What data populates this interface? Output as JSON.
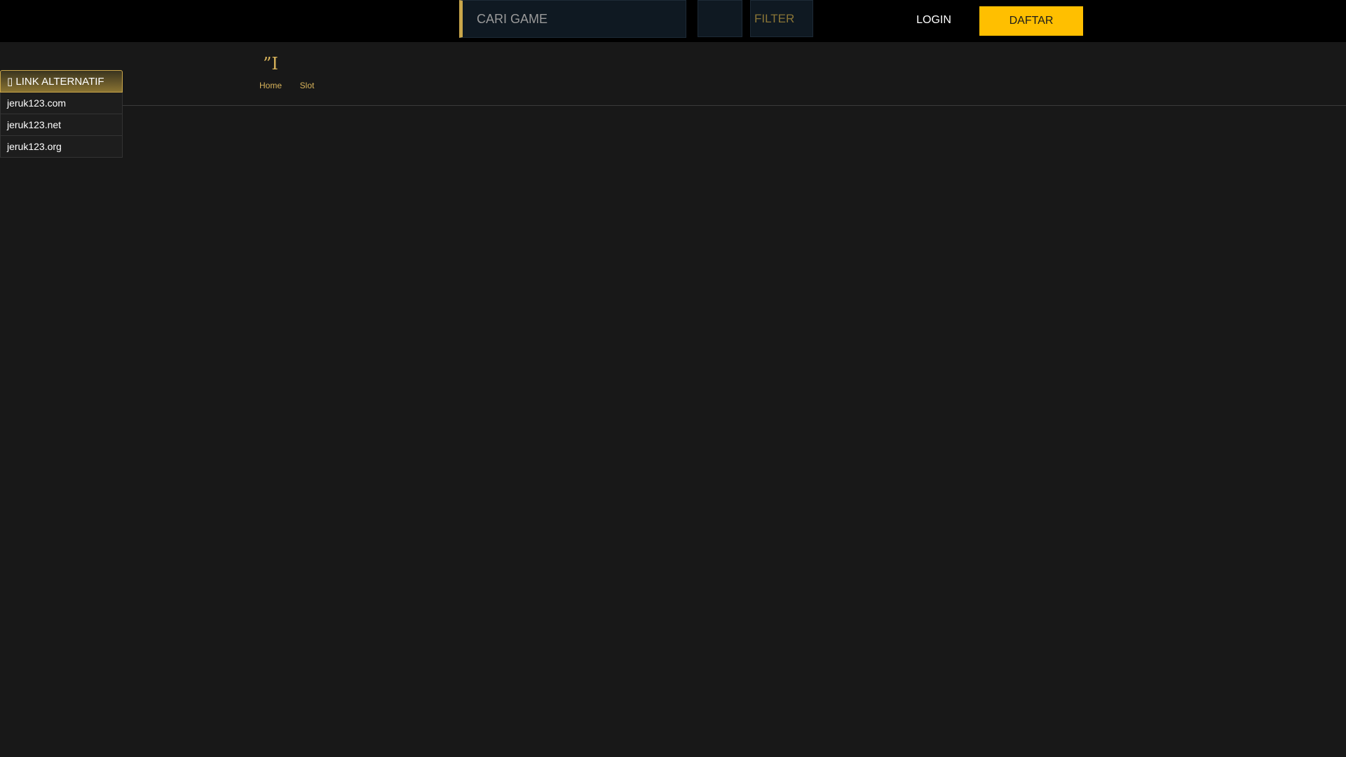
{
  "header": {
    "search_placeholder": "CARI GAME",
    "search_icon": "search-icon",
    "filter_label": "FILTER",
    "login_label": "LOGIN",
    "register_label": "DAFTAR",
    "accent_color": "#ffbf00"
  },
  "nav": {
    "items": [
      {
        "label": "Home",
        "icon": "home-icon",
        "glyph": "”I"
      },
      {
        "label": "Slot",
        "icon": "slot-icon",
        "glyph": ""
      }
    ]
  },
  "link_panel": {
    "title_icon": "link-icon",
    "title": "▯ LINK ALTERNATIF",
    "links": [
      "jeruk123.com",
      "jeruk123.net",
      "jeruk123.org"
    ]
  },
  "colors": {
    "background": "#181818",
    "topbar": "#000000",
    "gold": "#d8b35a"
  }
}
